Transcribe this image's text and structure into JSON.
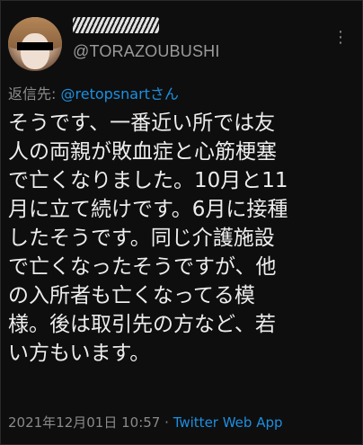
{
  "tweet": {
    "handle": "@TORAZOUBUSHI",
    "more_icon": "more-icon",
    "reply": {
      "prefix": "返信先:",
      "mention": "@retopsnartさん"
    },
    "lines": [
      "そうです、一番近い所では友",
      "人の両親が敗血症と心筋梗塞",
      "で亡くなりました。10月と11",
      "月に立て続けです。6月に接種",
      "したそうです。同じ介護施設",
      "で亡くなったそうですが、他",
      "の入所者も亡くなってる模",
      "様。後は取引先の方など、若",
      "い方もいます。"
    ],
    "timestamp": "2021年12月01日 10:57",
    "separator": "·",
    "app": "Twitter Web App"
  },
  "colors": {
    "background": "#0e0e0e",
    "text": "#ededed",
    "muted": "#8d8d8d",
    "link": "#1d8fe0"
  }
}
